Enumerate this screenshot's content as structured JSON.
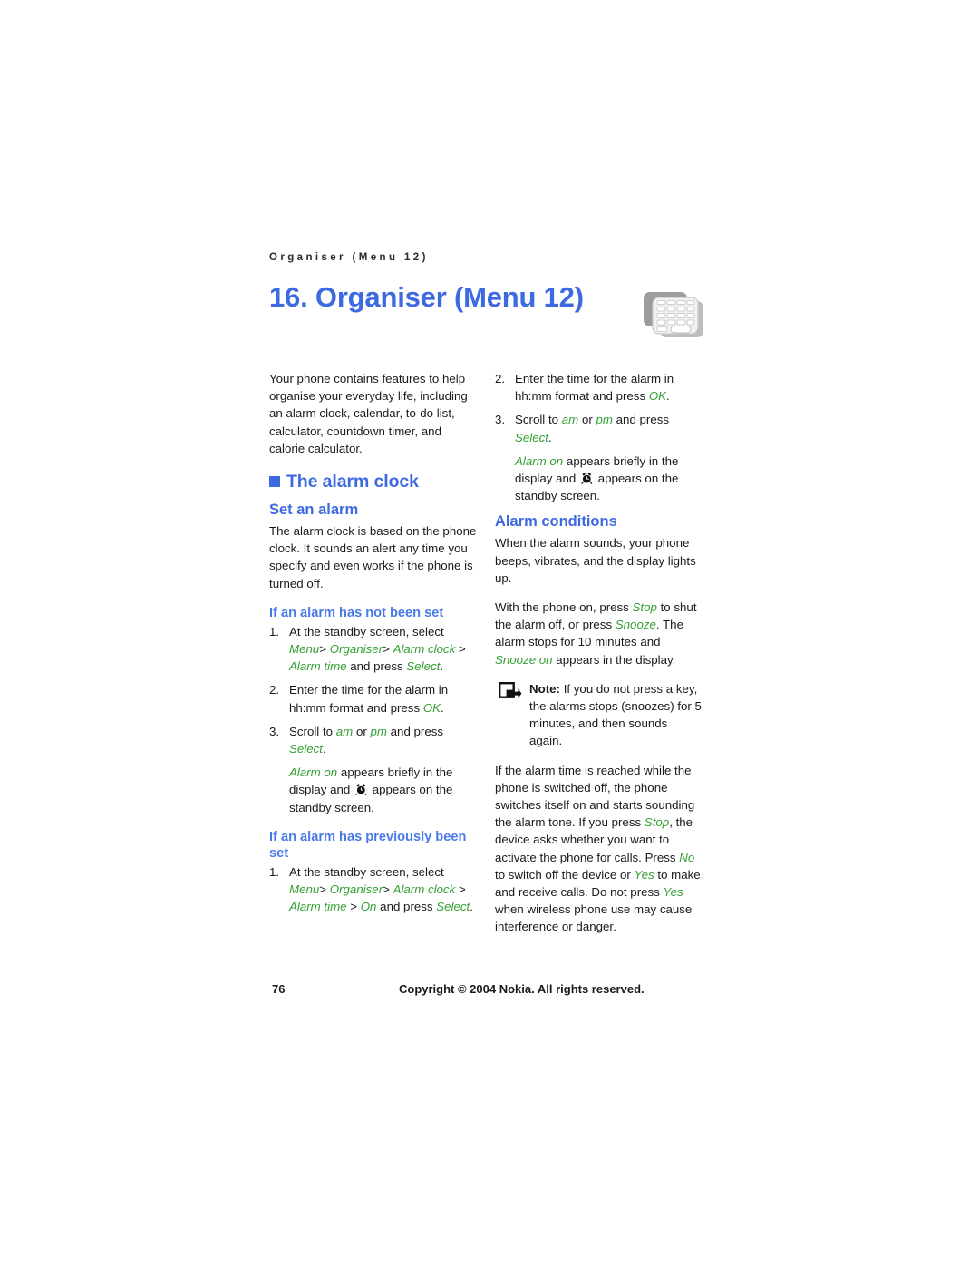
{
  "header": {
    "running_header": "Organiser (Menu 12)",
    "chapter_title": "16. Organiser (Menu 12)",
    "chapter_icon": "keypad-calculator-icon"
  },
  "left_column": {
    "intro": "Your phone contains features to help organise your everyday life, including an alarm clock, calendar, to-do list, calculator, countdown timer, and calorie calculator.",
    "section_heading": "The alarm clock",
    "set_alarm_heading": "Set an alarm",
    "set_alarm_body": "The alarm clock is based on the phone clock. It sounds an alert any time you specify and even works if the phone is turned off.",
    "not_set_heading": "If an alarm has not been set",
    "step1_num": "1.",
    "step1_text": "At the standby screen, select",
    "step1_menu": "Menu",
    "step1_sep1": ">",
    "step1_organiser": "Organiser",
    "step1_sep2": ">",
    "step1_alarm_clock": "Alarm clock",
    "step1_sep3": ">",
    "step1_alarm_time": "Alarm time",
    "step1_and_press": "and press",
    "step1_select": "Select",
    "step1_period": ".",
    "step2_num": "2.",
    "step2_text": "Enter the time for the alarm in hh:mm format and press",
    "step2_ok": "OK",
    "step2_period": ".",
    "step3_num": "3.",
    "step3_text_a": "Scroll to",
    "step3_am": "am",
    "step3_or": "or",
    "step3_pm": "pm",
    "step3_text_b": "and press",
    "step3_select": "Select",
    "step3_period": ".",
    "alarm_on": "Alarm on",
    "alarm_on_rest_a": "appears briefly in the display and",
    "alarm_icon": "alarm-clock-icon",
    "alarm_on_rest_b": "appears on the standby screen.",
    "prev_set_heading": "If an alarm has previously been set",
    "prev_step1_num": "1.",
    "prev_step1_text": "At the standby screen, select",
    "prev_step1_menu": "Menu",
    "prev_step1_sep1": ">",
    "prev_step1_organiser": "Organiser",
    "prev_step1_sep2": ">",
    "prev_step1_alarm_clock": "Alarm clock",
    "prev_step1_sep3": ">",
    "prev_step1_alarm_time": "Alarm time",
    "prev_step1_sep4": ">",
    "prev_step1_on": "On",
    "prev_step1_and_press": "and press",
    "prev_step1_select": "Select",
    "prev_step1_period": "."
  },
  "right_column": {
    "step2_num": "2.",
    "step2_text": "Enter the time for the alarm in hh:mm format and press",
    "step2_ok": "OK",
    "step2_period": ".",
    "step3_num": "3.",
    "step3_text_a": "Scroll to",
    "step3_am": "am",
    "step3_or": "or",
    "step3_pm": "pm",
    "step3_text_b": "and press",
    "step3_select": "Select",
    "step3_period": ".",
    "alarm_on": "Alarm on",
    "alarm_on_rest_a": "appears briefly in the display and",
    "alarm_icon": "alarm-clock-icon",
    "alarm_on_rest_b": "appears on the standby screen.",
    "conditions_heading": "Alarm conditions",
    "conditions_p1": "When the alarm sounds, your phone beeps, vibrates, and the display lights up.",
    "conditions_p2_a": "With the phone on, press",
    "conditions_stop": "Stop",
    "conditions_p2_b": "to shut the alarm off, or press",
    "conditions_snooze": "Snooze",
    "conditions_p2_c": ". The alarm stops for 10 minutes and",
    "conditions_snooze_on": "Snooze on",
    "conditions_p2_d": "appears in the display.",
    "note_icon": "note-arrow-icon",
    "note_label": "Note:",
    "note_text": "If you do not press a key, the alarms stops (snoozes) for 5 minutes, and then sounds again.",
    "final_p_a": "If the alarm time is reached while the phone is switched off, the phone switches itself on and starts sounding the alarm tone. If you press",
    "final_stop": "Stop",
    "final_p_b": ", the device asks whether you want to activate the phone for calls. Press",
    "final_no": "No",
    "final_p_c": "to switch off the device or",
    "final_yes1": "Yes",
    "final_p_d": "to make and receive calls. Do not press",
    "final_yes2": "Yes",
    "final_p_e": "when wireless phone use may cause interference or danger."
  },
  "footer": {
    "page_number": "76",
    "copyright": "Copyright © 2004 Nokia. All rights reserved."
  },
  "colors": {
    "heading_blue": "#3d6ae0",
    "ui_green": "#33a033",
    "body_black": "#1a1a1a",
    "page_background": "#ffffff"
  }
}
